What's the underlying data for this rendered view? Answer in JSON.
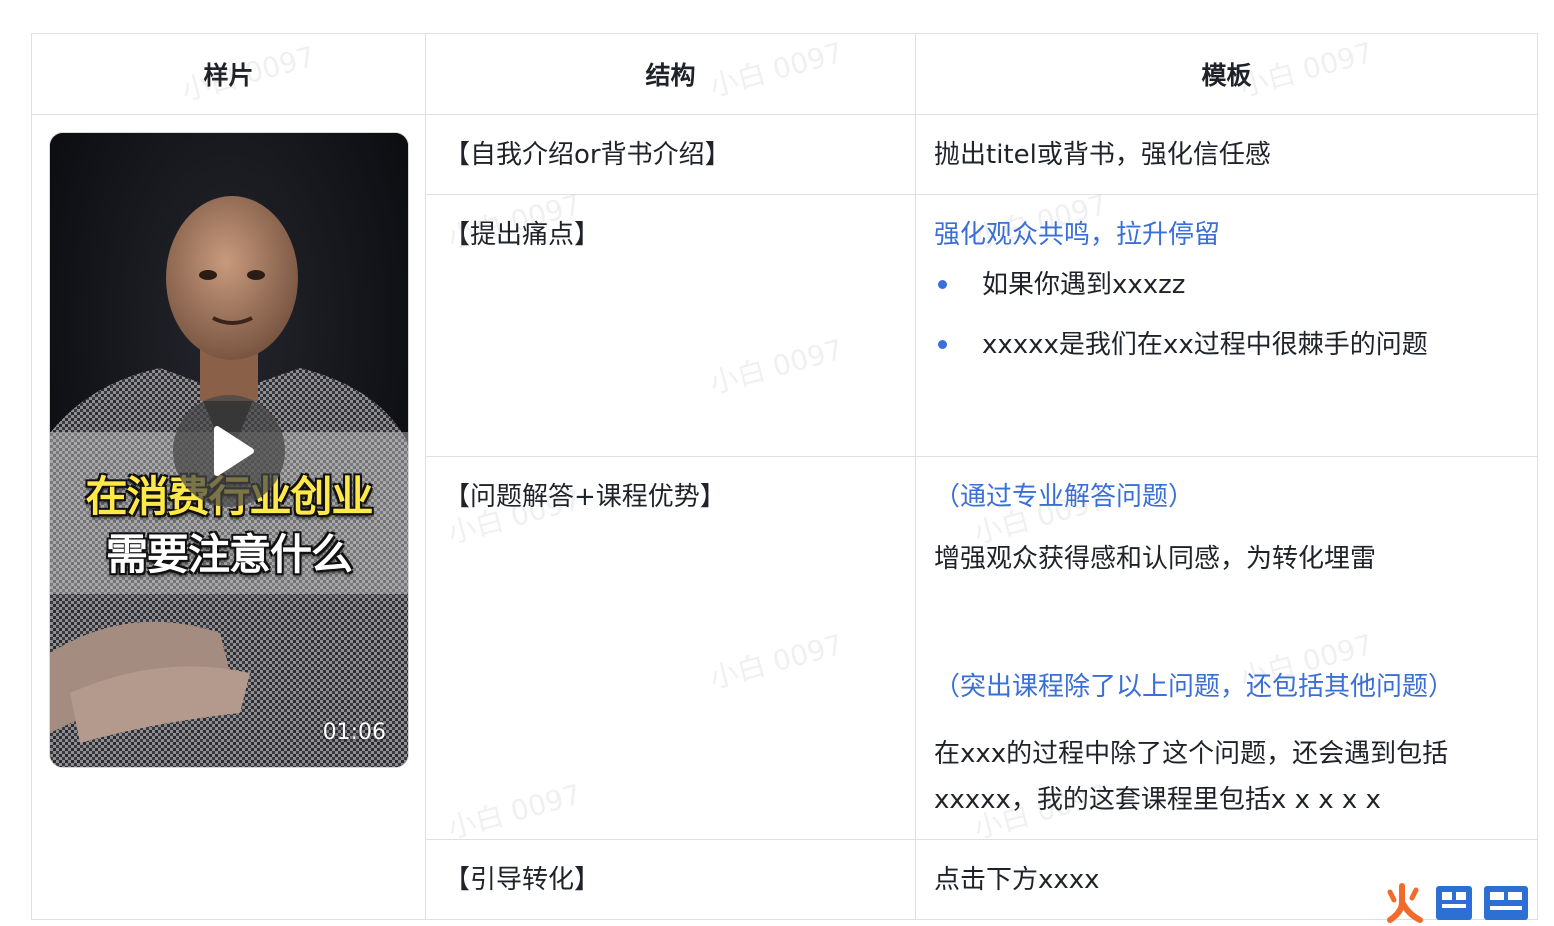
{
  "table": {
    "headers": [
      "样片",
      "结构",
      "模板"
    ],
    "sample_video": {
      "caption_line1": "在消费行业创业",
      "caption_line2": "需要注意什么",
      "duration": "01:06"
    },
    "rows": [
      {
        "structure": "【自我介绍or背书介绍】",
        "template_text": "抛出titel或背书，强化信任感"
      },
      {
        "structure": "【提出痛点】",
        "template_highlight": "强化观众共鸣，拉升停留",
        "template_bullets": [
          "如果你遇到xxxzz",
          "xxxxx是我们在xx过程中很棘手的问题"
        ]
      },
      {
        "structure": "【问题解答+课程优势】",
        "template_highlight_1": "（通过专业解答问题）",
        "template_text_1": "增强观众获得感和认同感，为转化埋雷",
        "template_highlight_2": "（突出课程除了以上问题，还包括其他问题）",
        "template_text_2": "在xxx的过程中除了这个问题，还会遇到包括xxxxx，我的这套课程里包括x x x x x"
      },
      {
        "structure": "【引导转化】",
        "template_text": "点击下方xxxx"
      }
    ]
  },
  "watermark_text": "小白 0097",
  "logo_text": "火鲤鱼",
  "colors": {
    "highlight": "#3a6fd8",
    "border": "#dee0e3",
    "logo_orange": "#f26b2a",
    "logo_blue": "#2d6fd2"
  },
  "icons": [
    "play-icon",
    "bullet-dot-icon"
  ]
}
